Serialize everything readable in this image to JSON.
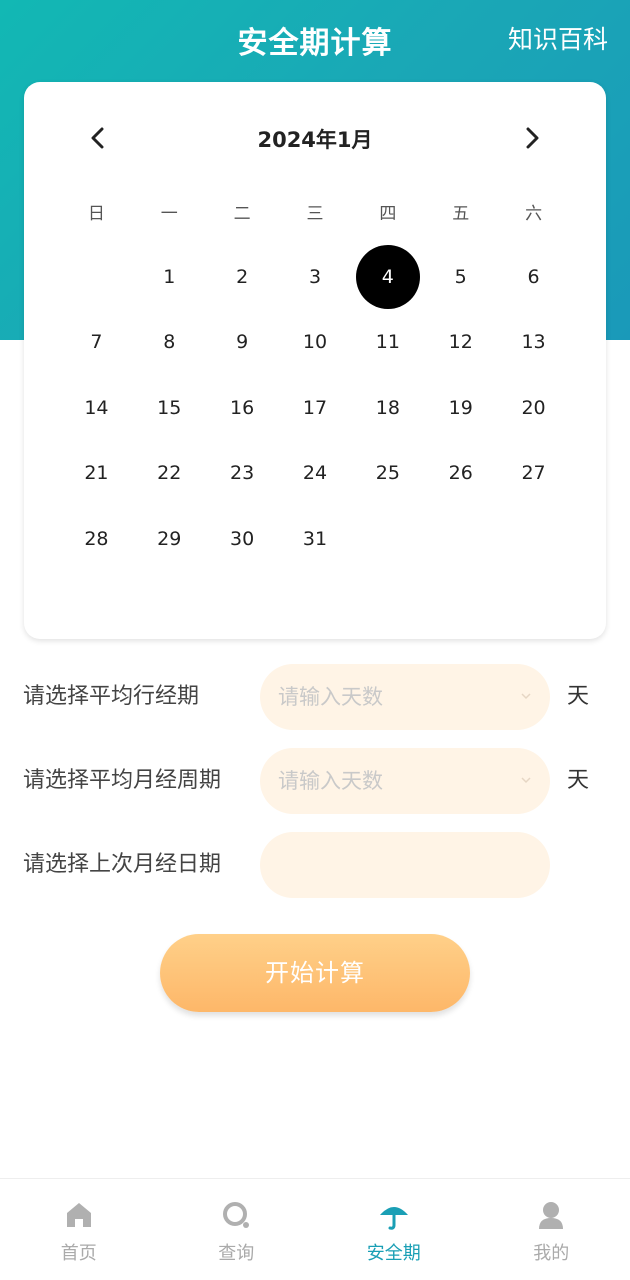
{
  "header": {
    "title": "安全期计算",
    "knowledge_link": "知识百科"
  },
  "calendar": {
    "month_label": "2024年1月",
    "weekdays": [
      "日",
      "一",
      "二",
      "三",
      "四",
      "五",
      "六"
    ],
    "leading_blanks": 1,
    "days": [
      "1",
      "2",
      "3",
      "4",
      "5",
      "6",
      "7",
      "8",
      "9",
      "10",
      "11",
      "12",
      "13",
      "14",
      "15",
      "16",
      "17",
      "18",
      "19",
      "20",
      "21",
      "22",
      "23",
      "24",
      "25",
      "26",
      "27",
      "28",
      "29",
      "30",
      "31"
    ],
    "selected_day": "4"
  },
  "form": {
    "period_label": "请选择平均行经期",
    "period_placeholder": "请输入天数",
    "period_unit": "天",
    "cycle_label": "请选择平均月经周期",
    "cycle_placeholder": "请输入天数",
    "cycle_unit": "天",
    "last_date_label": "请选择上次月经日期",
    "last_date_value": ""
  },
  "start_button": "开始计算",
  "tabbar": {
    "items": [
      {
        "label": "首页",
        "icon": "home-icon",
        "active": false
      },
      {
        "label": "查询",
        "icon": "search-icon",
        "active": false
      },
      {
        "label": "安全期",
        "icon": "umbrella-icon",
        "active": true
      },
      {
        "label": "我的",
        "icon": "user-icon",
        "active": false
      }
    ]
  },
  "colors": {
    "header_teal": "#12b8b4",
    "field_bg": "#fff4e6",
    "button_orange": "#fdb769",
    "active_tab": "#1a9fb5"
  }
}
